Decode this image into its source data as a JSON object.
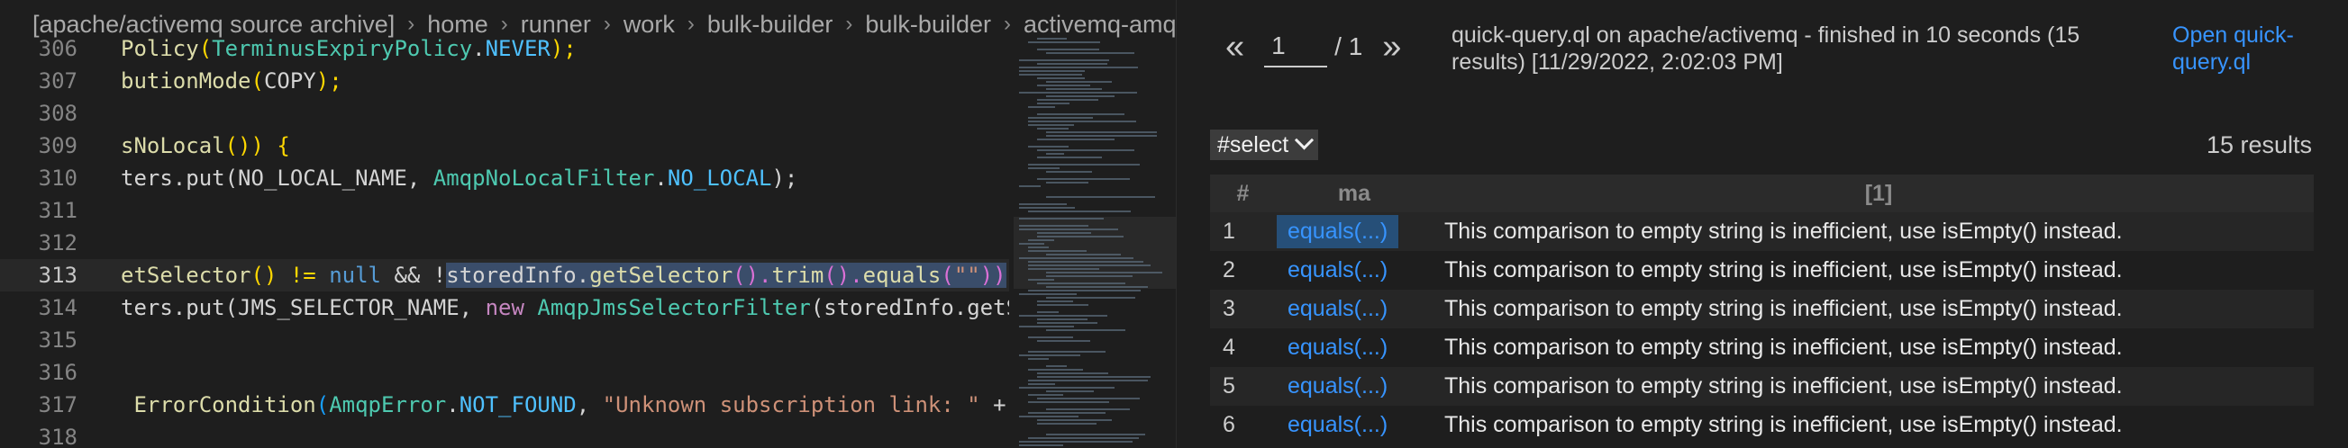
{
  "editor": {
    "breadcrumb": [
      "[apache/activemq source archive]",
      "home",
      "runner",
      "work",
      "bulk-builder",
      "bulk-builder",
      "activemq-amq"
    ],
    "breadcrumb_separator": "›",
    "lines": [
      {
        "n": "306",
        "frag": [
          "Policy",
          "(",
          "TerminusExpiryPolicy",
          ".",
          "NEVER",
          ");"
        ]
      },
      {
        "n": "307",
        "frag": [
          "butionMode",
          "(",
          "COPY",
          ");"
        ]
      },
      {
        "n": "308"
      },
      {
        "n": "309",
        "frag": [
          "sNoLocal",
          "()) {"
        ]
      },
      {
        "n": "310",
        "frag": [
          "ters.put(NO_LOCAL_NAME, ",
          "AmqpNoLocalFilter",
          ".",
          "NO_LOCAL",
          ");"
        ]
      },
      {
        "n": "311"
      },
      {
        "n": "312"
      },
      {
        "n": "313",
        "frag": [
          "etSelector",
          "() != ",
          "null",
          " && !",
          "storedInfo",
          ".",
          "getSelector",
          "().",
          "trim",
          "().",
          "equals",
          "(",
          "\"\"",
          "))"
        ]
      },
      {
        "n": "314",
        "frag": [
          "ters.put(JMS_SELECTOR_NAME, ",
          "new",
          " ",
          "AmqpJmsSelectorFilter",
          "(storedInfo.getS"
        ]
      },
      {
        "n": "315"
      },
      {
        "n": "316"
      },
      {
        "n": "317",
        "frag": [
          " ErrorCondition",
          "(",
          "AmqpError",
          ".",
          "NOT_FOUND",
          ", ",
          "\"Unknown subscription link: \"",
          " +"
        ]
      },
      {
        "n": "318"
      }
    ]
  },
  "results": {
    "prev_label": "«",
    "next_label": "»",
    "page_value": "1",
    "page_total": "/ 1",
    "status": "quick-query.ql on apache/activemq - finished in 10 seconds (15 results) [11/29/2022, 2:02:03 PM]",
    "open_link": "Open quick-query.ql",
    "result_set": "#select",
    "count": "15 results",
    "columns": [
      "#",
      "ma",
      "[1]"
    ],
    "rows": [
      {
        "num": "1",
        "ma": "equals(...)",
        "msg": "This comparison to empty string is inefficient, use isEmpty() instead."
      },
      {
        "num": "2",
        "ma": "equals(...)",
        "msg": "This comparison to empty string is inefficient, use isEmpty() instead."
      },
      {
        "num": "3",
        "ma": "equals(...)",
        "msg": "This comparison to empty string is inefficient, use isEmpty() instead."
      },
      {
        "num": "4",
        "ma": "equals(...)",
        "msg": "This comparison to empty string is inefficient, use isEmpty() instead."
      },
      {
        "num": "5",
        "ma": "equals(...)",
        "msg": "This comparison to empty string is inefficient, use isEmpty() instead."
      },
      {
        "num": "6",
        "ma": "equals(...)",
        "msg": "This comparison to empty string is inefficient, use isEmpty() instead."
      }
    ]
  }
}
